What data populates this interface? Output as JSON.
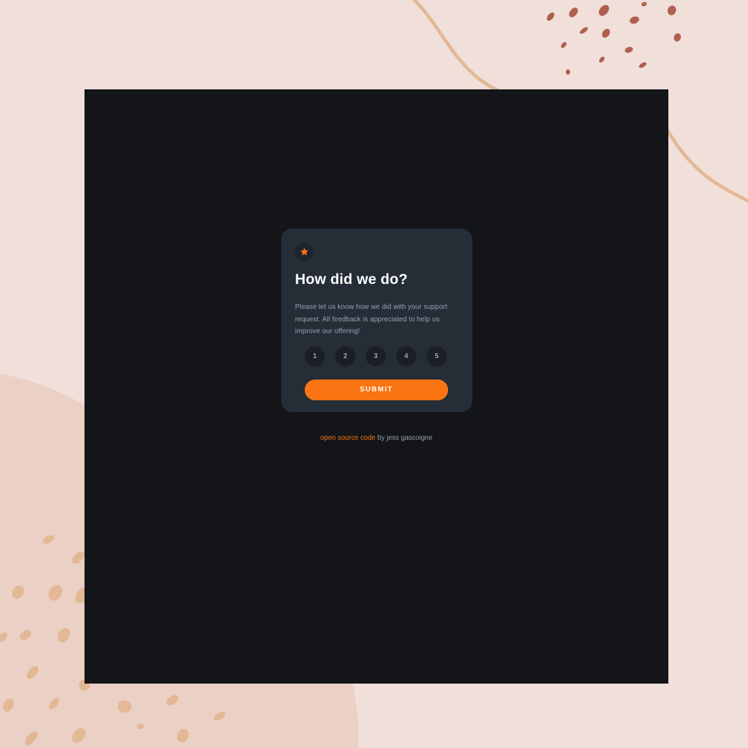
{
  "colors": {
    "page_background": "#f1dfda",
    "screen_background": "#141519",
    "card_background": "#252d37",
    "accent": "#fb7413",
    "title_text": "#ffffff",
    "body_text": "#9aa3af",
    "rating_background": "#1b1f25",
    "decor_curve": "#e3b894",
    "decor_dots_dark": "#b0604e",
    "decor_dots_light": "#e3b894",
    "decor_blob": "#ebd0c6"
  },
  "card": {
    "icon": "star-icon",
    "title": "How did we do?",
    "description": "Please let us know how we did with your support request. All feedback is appreciated to help us improve our offering!",
    "ratings": [
      "1",
      "2",
      "3",
      "4",
      "5"
    ],
    "submit_label": "SUBMIT"
  },
  "attribution": {
    "link_text": "open source code",
    "suffix_text": " by jess gascoigne"
  }
}
